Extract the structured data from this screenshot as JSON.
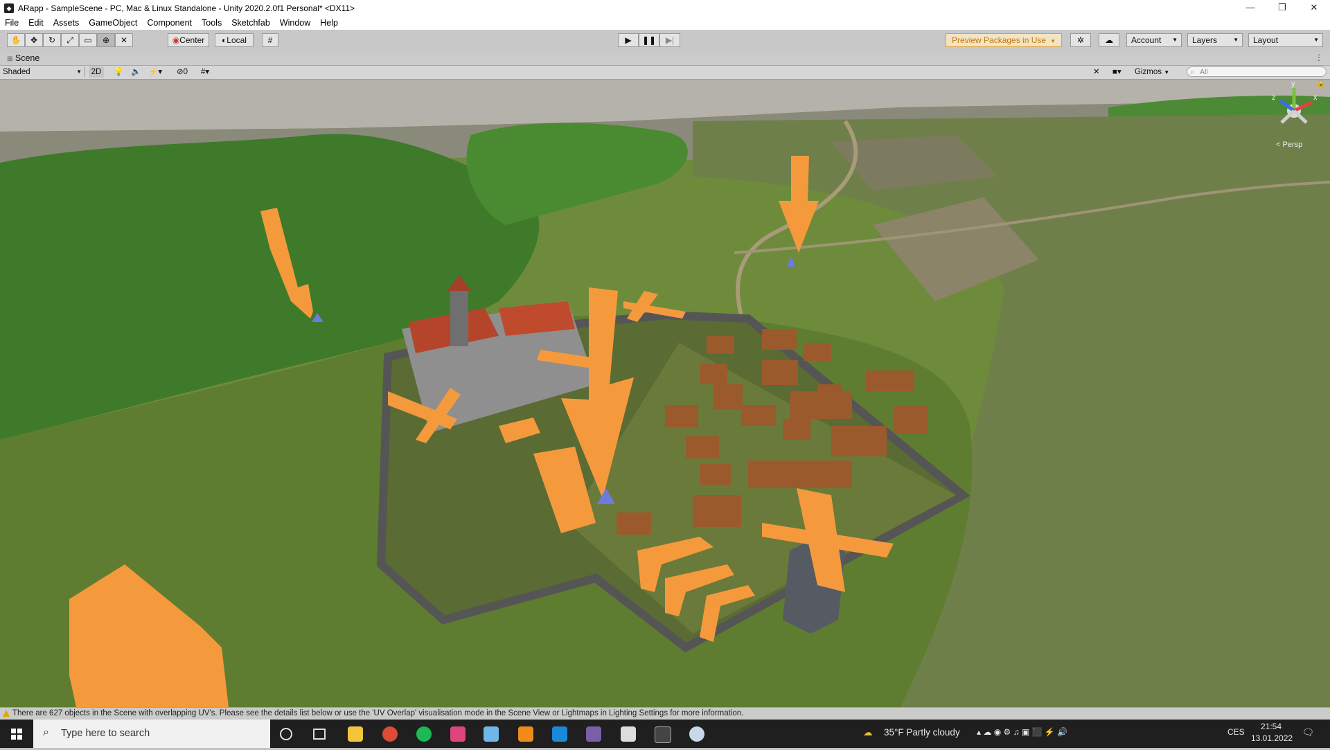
{
  "window": {
    "title": "ARapp - SampleScene - PC, Mac & Linux Standalone - Unity 2020.2.0f1 Personal* <DX11>",
    "minimize": "—",
    "restore": "❐",
    "close": "✕"
  },
  "menu": [
    "File",
    "Edit",
    "Assets",
    "GameObject",
    "Component",
    "Tools",
    "Sketchfab",
    "Window",
    "Help"
  ],
  "toolbar": {
    "center_label": "Center",
    "local_label": "Local",
    "preview_packages": "Preview Packages in Use",
    "account": "Account",
    "layers": "Layers",
    "layout": "Layout",
    "accent_color": "#f0a030"
  },
  "scene": {
    "tab_label": "Scene",
    "shading_mode": "Shaded",
    "mode_2d": "2D",
    "hidden_count": "0",
    "gizmos_label": "Gizmos",
    "search_placeholder": "All",
    "projection_label": "< Persp",
    "axis_x": "x",
    "axis_y": "y",
    "axis_z": "z"
  },
  "status": {
    "message": "There are 627 objects in the Scene with overlapping UV's. Please see the details list below or use the 'UV Overlap' visualisation mode in the Scene View or Lightmaps in Lighting Settings for more information."
  },
  "taskbar": {
    "search_placeholder": "Type here to search",
    "weather": "35°F  Partly cloudy",
    "language": "CES",
    "time": "21:54",
    "date": "13.01.2022"
  }
}
